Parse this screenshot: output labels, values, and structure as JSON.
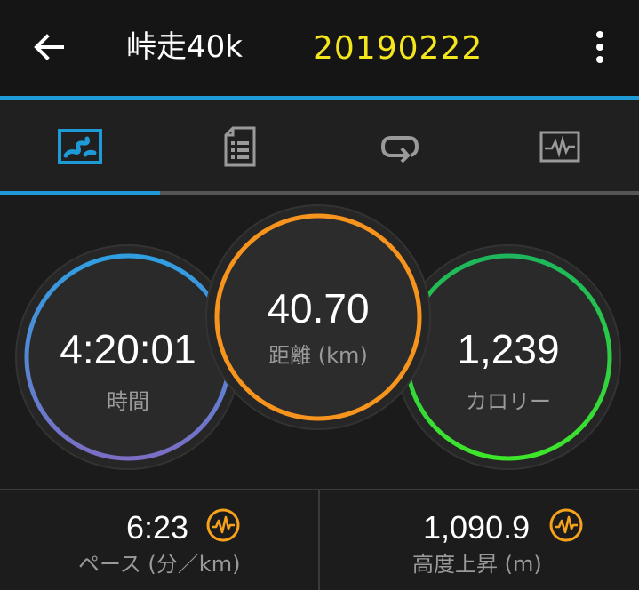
{
  "header": {
    "title": "峠走40k",
    "date": "20190222"
  },
  "tabs": [
    {
      "icon": "map-route-icon",
      "active": true
    },
    {
      "icon": "details-list-icon",
      "active": false
    },
    {
      "icon": "laps-loop-icon",
      "active": false
    },
    {
      "icon": "graph-chart-icon",
      "active": false
    }
  ],
  "circles": {
    "time": {
      "value": "4:20:01",
      "label": "時間"
    },
    "distance": {
      "value": "40.70",
      "label": "距離 (km)"
    },
    "calories": {
      "value": "1,239",
      "label": "カロリー"
    }
  },
  "stats": {
    "pace": {
      "value": "6:23",
      "label": "ペース (分／km)"
    },
    "elevation": {
      "value": "1,090.9",
      "label": "高度上昇 (m)"
    }
  },
  "colors": {
    "accent": "#1e9ad6",
    "date": "#f4e61c",
    "distance_ring": "#f7941d",
    "stat_icon": "#f7a21b"
  }
}
